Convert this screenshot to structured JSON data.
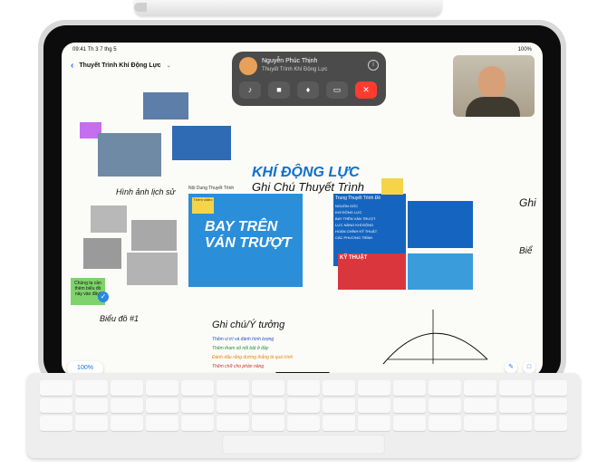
{
  "status": {
    "time": "09:41",
    "date": "Th 3 7 thg 5",
    "battery": "100%"
  },
  "toolbar": {
    "title": "Thuyết Trình Khí Động Lực"
  },
  "facetime": {
    "name": "Nguyễn Phúc Thịnh",
    "subtitle": "Thuyết Trình Khí Động Lực"
  },
  "board": {
    "title_main": "KHÍ ĐỘNG LỰC",
    "title_sub": "Ghi Chú Thuyết Trình",
    "history_heading": "Hình ảnh lịch sử",
    "poster_caption": "Nội Dung Thuyết Trình",
    "poster_text": "BAY TRÊN VÁN TRƯỢT",
    "poster_sticky": "Thêm video",
    "list_title": "Trung Thuyết Trình Đề",
    "list_items": [
      "NGUỒN GỐC",
      "KHÍ ĐỘNG LỰC",
      "BAY TRÊN VÁN TRƯỢT",
      "LỰC NÂNG KHÍ ĐỘNG",
      "HOÀN CHỈNH KỸ THUẬT",
      "CÁC PHƯƠNG TRÌNH"
    ],
    "ky_thuat": "KỸ THUẬT",
    "green_sticky": "Chúng ta cần thêm biểu đồ này vào đây!",
    "chart_heading": "Biểu đồ #1",
    "notes_heading": "Ghi chú/Ý tưởng",
    "bullets": [
      "Thêm vị trí và đánh hình lượng",
      "Thêm tham số nổi bật ở đây",
      "Đánh dấu rằng đường thẳng là quá trình",
      "Thêm chữ cho phần nâng"
    ],
    "right_heading": "Ghi",
    "right_heading2": "Biể",
    "zoom": "100%"
  }
}
